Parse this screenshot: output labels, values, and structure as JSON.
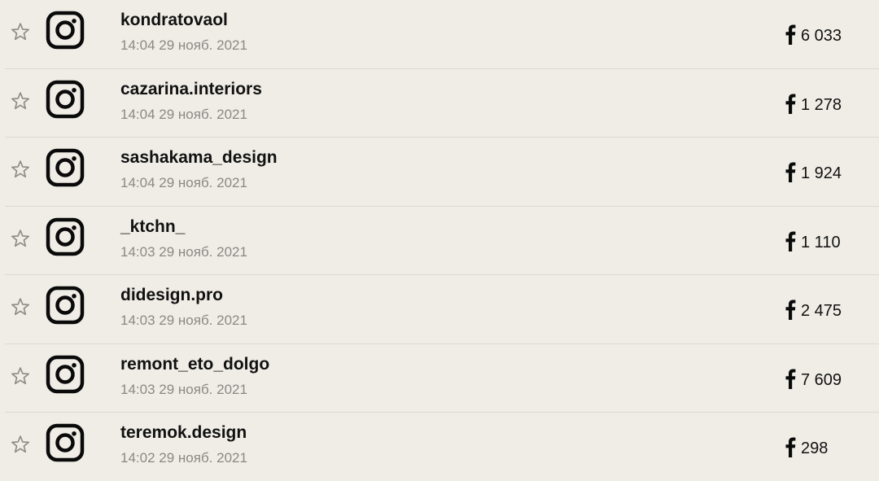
{
  "items": [
    {
      "name": "kondratovaol",
      "time": "14:04 29 нояб. 2021",
      "count": "6 033"
    },
    {
      "name": "cazarina.interiors",
      "time": "14:04 29 нояб. 2021",
      "count": "1 278"
    },
    {
      "name": "sashakama_design",
      "time": "14:04 29 нояб. 2021",
      "count": "1 924"
    },
    {
      "name": "_ktchn_",
      "time": "14:03 29 нояб. 2021",
      "count": "1 110"
    },
    {
      "name": "didesign.pro",
      "time": "14:03 29 нояб. 2021",
      "count": "2 475"
    },
    {
      "name": "remont_eto_dolgo",
      "time": "14:03 29 нояб. 2021",
      "count": "7 609"
    },
    {
      "name": "teremok.design",
      "time": "14:02 29 нояб. 2021",
      "count": "298"
    }
  ],
  "icons": {
    "star": "star-icon",
    "platform": "instagram-icon",
    "metric": "facebook-icon"
  },
  "colors": {
    "background": "#efede6",
    "divider": "#dcdad3",
    "name": "#111111",
    "time": "#8a8985",
    "star_outline": "#8c8b87"
  }
}
